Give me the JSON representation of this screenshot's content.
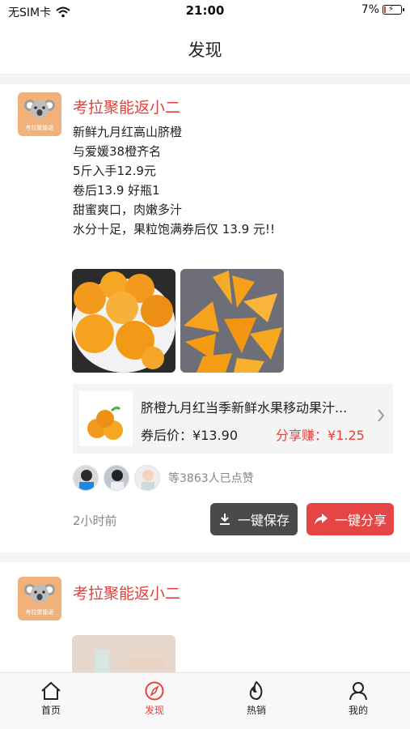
{
  "status_bar": {
    "carrier": "无SIM卡",
    "time": "21:00",
    "battery": "7%"
  },
  "nav": {
    "title": "发现"
  },
  "posts": [
    {
      "author": "考拉聚能返小二",
      "avatar_tag": "考拉聚能返",
      "lines": [
        "新鲜九月红高山脐橙",
        "与爱媛38橙齐名",
        "5斤入手12.9元",
        "卷后13.9 好瓶1",
        "甜蜜爽口，肉嫩多汁",
        "水分十足，果粒饱满券后仅 13.9 元!!"
      ],
      "product": {
        "title": "脐橙九月红当季新鲜水果移动果汁...",
        "price_label": "券后价：",
        "price": "¥13.90",
        "share_label": "分享赚：",
        "share_amount": "¥1.25"
      },
      "likes_text": "等3863人已点赞",
      "time_ago": "2小时前",
      "save_label": "一键保存",
      "share_label": "一键分享"
    },
    {
      "author": "考拉聚能返小二",
      "avatar_tag": "考拉聚能返"
    }
  ],
  "tabs": [
    {
      "label": "首页",
      "icon": "home-icon"
    },
    {
      "label": "发现",
      "icon": "compass-icon",
      "active": true
    },
    {
      "label": "热销",
      "icon": "flame-icon"
    },
    {
      "label": "我的",
      "icon": "user-icon"
    }
  ],
  "colors": {
    "accent": "#e0443e",
    "save_button": "#4a4a4a",
    "share_button": "#e64545"
  }
}
